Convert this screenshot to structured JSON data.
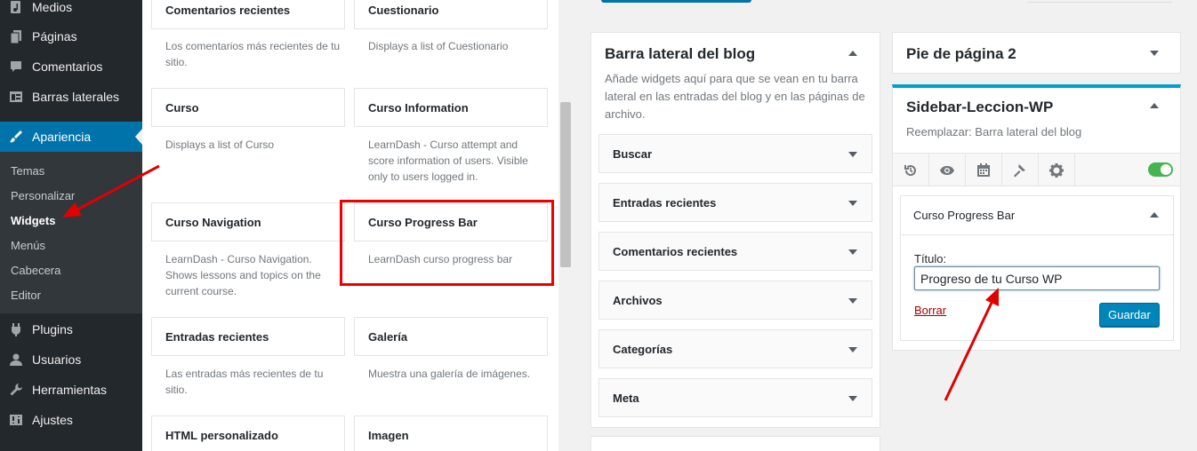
{
  "admin_menu": {
    "items": [
      {
        "label": "Medios",
        "icon": "media-icon"
      },
      {
        "label": "Páginas",
        "icon": "pages-icon"
      },
      {
        "label": "Comentarios",
        "icon": "comments-icon"
      },
      {
        "label": "Barras laterales",
        "icon": "sidebars-icon"
      },
      {
        "label": "Apariencia",
        "icon": "appearance-icon",
        "current": true
      },
      {
        "label": "Plugins",
        "icon": "plugins-icon"
      },
      {
        "label": "Usuarios",
        "icon": "users-icon"
      },
      {
        "label": "Herramientas",
        "icon": "tools-icon"
      },
      {
        "label": "Ajustes",
        "icon": "settings-icon"
      }
    ],
    "submenu": [
      "Temas",
      "Personalizar",
      "Widgets",
      "Menús",
      "Cabecera",
      "Editor"
    ],
    "submenu_current": "Widgets"
  },
  "available_widgets": [
    {
      "title": "Comentarios recientes",
      "desc": "Los comentarios más recientes de tu sitio."
    },
    {
      "title": "Cuestionario",
      "desc": "Displays a list of Cuestionario"
    },
    {
      "title": "Curso",
      "desc": "Displays a list of Curso"
    },
    {
      "title": "Curso Information",
      "desc": "LearnDash - Curso attempt and score information of users. Visible only to users logged in."
    },
    {
      "title": "Curso Navigation",
      "desc": "LearnDash - Curso Navigation. Shows lessons and topics on the current course."
    },
    {
      "title": "Curso Progress Bar",
      "desc": "LearnDash curso progress bar"
    },
    {
      "title": "Entradas recientes",
      "desc": "Las entradas más recientes de tu sitio."
    },
    {
      "title": "Galería",
      "desc": "Muestra una galería de imágenes."
    },
    {
      "title": "HTML personalizado",
      "desc": ""
    },
    {
      "title": "Imagen",
      "desc": ""
    }
  ],
  "blog_sidebar": {
    "title": "Barra lateral del blog",
    "description": "Añade widgets aquí para que se vean en tu barra lateral en las entradas del blog y en las páginas de archivo.",
    "widgets": [
      "Buscar",
      "Entradas recientes",
      "Comentarios recientes",
      "Archivos",
      "Categorías",
      "Meta"
    ]
  },
  "footer_area": {
    "title": "Pie de página 2"
  },
  "leccion_sidebar": {
    "title": "Sidebar-Leccion-WP",
    "description": "Reemplazar: Barra lateral del blog",
    "toolbar_icons": [
      "history-icon",
      "eye-icon",
      "calendar-icon",
      "hammer-icon",
      "gear-icon"
    ],
    "toggle_on": true,
    "accent_color": "#00a0d2"
  },
  "progress_widget": {
    "title": "Curso Progress Bar",
    "field_label": "Título:",
    "field_value": "Progreso de tu Curso WP",
    "delete_label": "Borrar",
    "save_label": "Guardar"
  },
  "colors": {
    "admin_bg": "#23282d",
    "admin_current": "#0073aa",
    "annotation_red": "#e00000",
    "save_button": "#0085ba"
  }
}
